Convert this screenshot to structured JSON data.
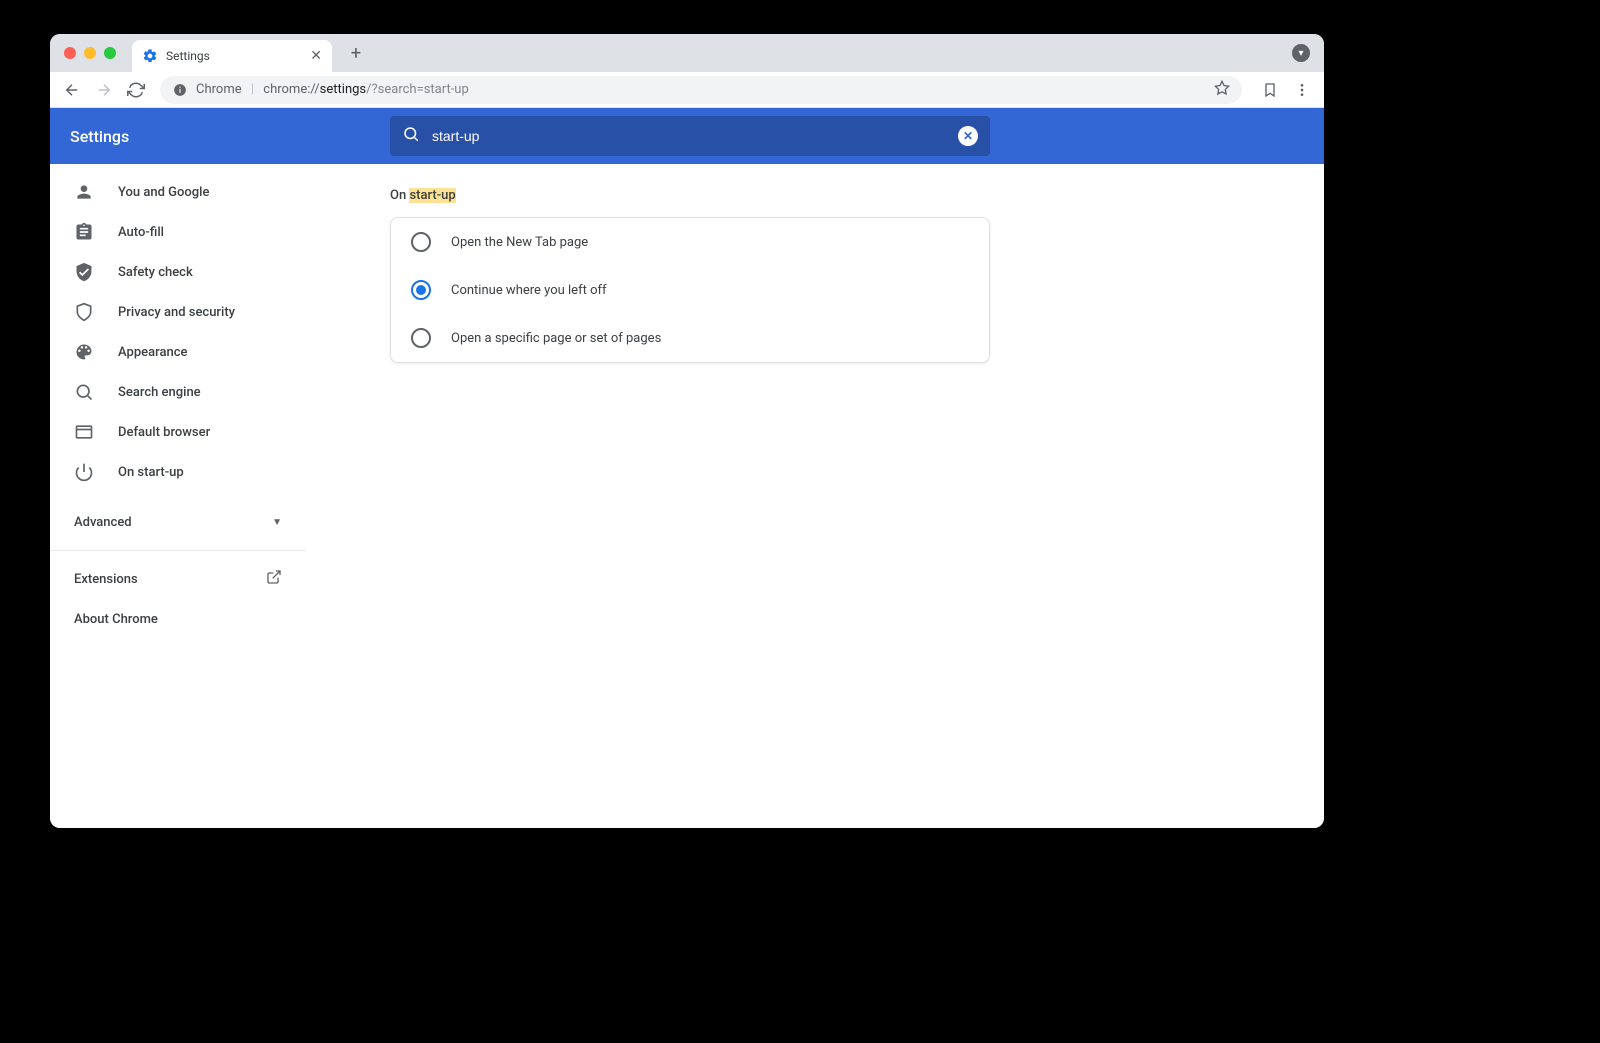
{
  "browser": {
    "tab_title": "Settings",
    "url_host": "Chrome",
    "url_prefix": "chrome://",
    "url_bold": "settings",
    "url_query": "/?search=start-up"
  },
  "header": {
    "title": "Settings",
    "search_value": "start-up"
  },
  "sidebar": {
    "items": [
      {
        "label": "You and Google"
      },
      {
        "label": "Auto-fill"
      },
      {
        "label": "Safety check"
      },
      {
        "label": "Privacy and security"
      },
      {
        "label": "Appearance"
      },
      {
        "label": "Search engine"
      },
      {
        "label": "Default browser"
      },
      {
        "label": "On start-up"
      }
    ],
    "advanced_label": "Advanced",
    "extensions_label": "Extensions",
    "about_label": "About Chrome"
  },
  "main": {
    "section_prefix": "On ",
    "section_highlight": "start-up",
    "options": [
      {
        "label": "Open the New Tab page",
        "selected": false
      },
      {
        "label": "Continue where you left off",
        "selected": true
      },
      {
        "label": "Open a specific page or set of pages",
        "selected": false
      }
    ]
  }
}
